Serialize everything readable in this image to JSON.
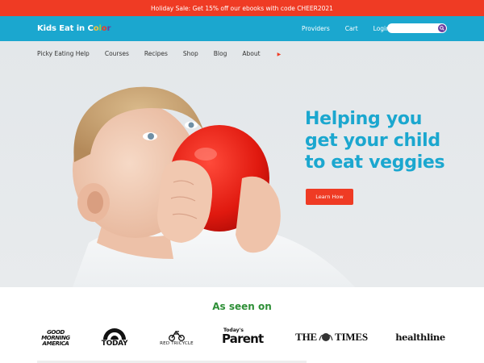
{
  "promo": {
    "text": "Holiday Sale: Get 15% off our ebooks with code CHEER2021"
  },
  "header": {
    "logo": {
      "text_a": "Kids Eat in C",
      "o1": "o",
      "l": "l",
      "o2": "o",
      "r": "r"
    },
    "nav": [
      "Providers",
      "Cart",
      "Login"
    ],
    "search": {
      "placeholder": ""
    }
  },
  "subnav": {
    "items": [
      "Picky Eating Help",
      "Courses",
      "Recipes",
      "Shop",
      "Blog",
      "About"
    ]
  },
  "hero": {
    "headline": [
      "Helping you",
      "get your child",
      "to eat veggies"
    ],
    "cta": "Learn How"
  },
  "seen_on": {
    "title": "As seen on",
    "brands": {
      "gma": [
        "GOOD",
        "MORNING",
        "AMERICA"
      ],
      "today": "TODAY",
      "redtricycle": "RED TRICYCLE",
      "parent_small": "Today's",
      "parent_big": "Parent",
      "times_a": "THE",
      "times_b": "TIMES",
      "healthline": "healthline"
    }
  },
  "colors": {
    "accent": "#1ba7cf",
    "promo": "#ef3b24",
    "cta": "#ef3b24",
    "seen_title": "#2e8f37"
  }
}
